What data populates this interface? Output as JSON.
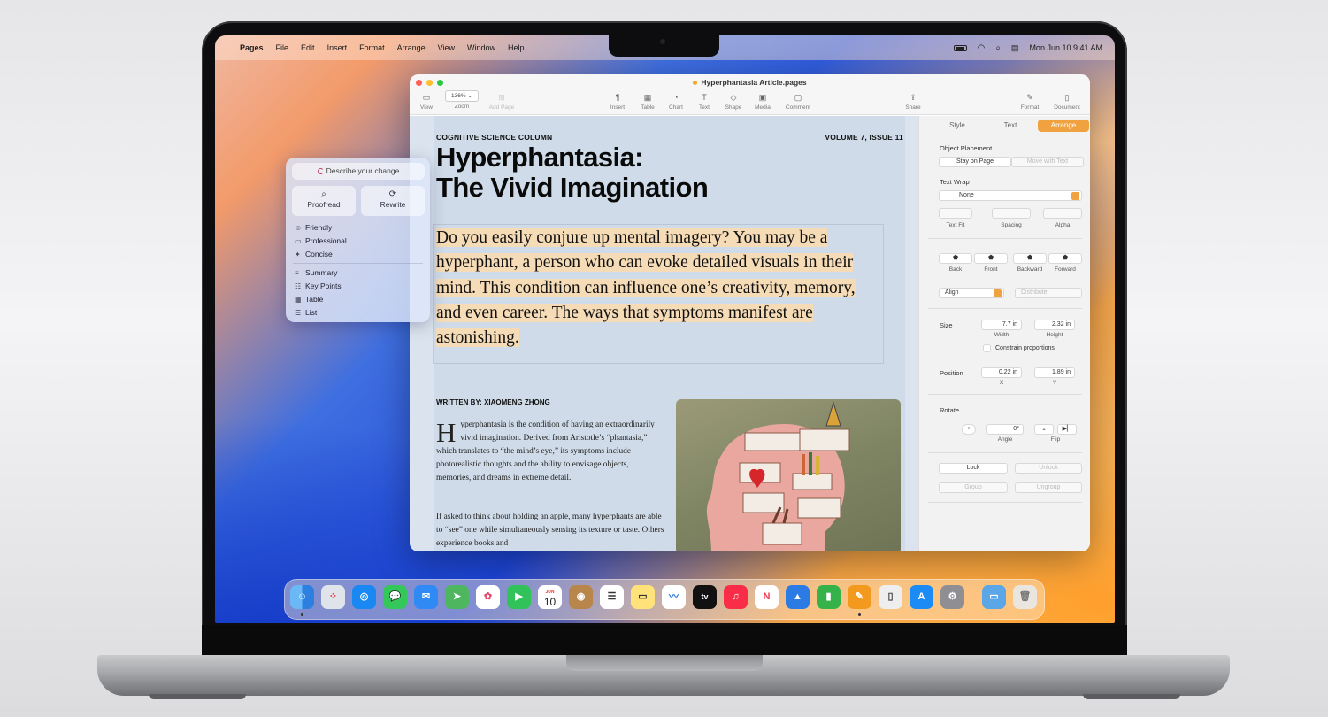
{
  "menubar": {
    "app": "Pages",
    "items": [
      "File",
      "Edit",
      "Insert",
      "Format",
      "Arrange",
      "View",
      "Window",
      "Help"
    ],
    "datetime": "Mon Jun 10  9:41 AM"
  },
  "window": {
    "title": "Hyperphantasia Article.pages",
    "zoom_value": "136% ⌄",
    "toolbar": [
      {
        "label": "View",
        "icon": "sidebar-icon"
      },
      {
        "label": "Zoom",
        "icon": "zoom-icon"
      },
      {
        "label": "Add Page",
        "icon": "add-page-icon"
      },
      {
        "label": "Insert",
        "icon": "insert-icon"
      },
      {
        "label": "Table",
        "icon": "table-icon"
      },
      {
        "label": "Chart",
        "icon": "chart-icon"
      },
      {
        "label": "Text",
        "icon": "text-icon"
      },
      {
        "label": "Shape",
        "icon": "shape-icon"
      },
      {
        "label": "Media",
        "icon": "media-icon"
      },
      {
        "label": "Comment",
        "icon": "comment-icon"
      },
      {
        "label": "Share",
        "icon": "share-icon"
      },
      {
        "label": "Format",
        "icon": "format-brush-icon"
      },
      {
        "label": "Document",
        "icon": "document-icon"
      }
    ]
  },
  "article": {
    "kicker_left": "COGNITIVE SCIENCE COLUMN",
    "kicker_right": "VOLUME 7, ISSUE 11",
    "headline_line1": "Hyperphantasia:",
    "headline_line2": "The Vivid Imagination",
    "lede": "Do you easily conjure up mental imagery? You may be a hyperphant, a person who can evoke detailed visuals in their mind. This condition can influence one’s creativity, memory, and even career. The ways that symptoms manifest are astonishing.",
    "byline": "WRITTEN BY: XIAOMENG ZHONG",
    "dropcap": "H",
    "body1": "yperphantasia is the condition of having an extraordinarily vivid imagination. Derived from Aristotle’s “phantasia,” which translates to “the mind’s eye,” its symptoms include photorealistic thoughts and the ability to envisage objects, memories, and dreams in extreme detail.",
    "body2": "If asked to think about holding an apple, many hyperphants are able to “see” one while simultaneously sensing its texture or taste. Others experience books and"
  },
  "writing_tools": {
    "input_placeholder": "Describe your change",
    "proofread": "Proofread",
    "rewrite": "Rewrite",
    "tones": [
      "Friendly",
      "Professional",
      "Concise"
    ],
    "formats": [
      "Summary",
      "Key Points",
      "Table",
      "List"
    ]
  },
  "inspector": {
    "tabs": [
      "Style",
      "Text",
      "Arrange"
    ],
    "object_placement": "Object Placement",
    "stay_on_page": "Stay on Page",
    "move_with_text": "Move with Text",
    "text_wrap": "Text Wrap",
    "wrap_value": "None",
    "text_fit": "Text Fit",
    "spacing": "Spacing",
    "alpha": "Alpha",
    "order": [
      "Back",
      "Front",
      "Backward",
      "Forward"
    ],
    "align": "Align",
    "distribute": "Distribute",
    "size": "Size",
    "width_value": "7.7 in",
    "height_value": "2.32 in",
    "width": "Width",
    "height": "Height",
    "constrain": "Constrain proportions",
    "position": "Position",
    "x_value": "0.22 in",
    "y_value": "1.89 in",
    "x": "X",
    "y": "Y",
    "rotate": "Rotate",
    "angle_value": "0°",
    "angle": "Angle",
    "flip": "Flip",
    "lock": "Lock",
    "unlock": "Unlock",
    "group": "Group",
    "ungroup": "Ungroup"
  },
  "dock": {
    "calendar_month": "JUN",
    "calendar_day": "10",
    "tv_label": "tv",
    "apps": [
      "finder-icon",
      "launchpad-icon",
      "safari-icon",
      "messages-icon",
      "mail-icon",
      "maps-icon",
      "photos-icon",
      "facetime-icon",
      "calendar-icon",
      "contacts-icon",
      "reminders-icon",
      "notes-icon",
      "freeform-icon",
      "apple-tv-icon",
      "music-icon",
      "news-icon",
      "keynote-icon",
      "numbers-icon",
      "pages-icon",
      "iphone-mirroring-icon",
      "app-store-icon",
      "system-settings-icon",
      "downloads-folder-icon",
      "trash-icon"
    ],
    "colors": {
      "accent": "#f0a240",
      "highlight": "#f5dcb7"
    }
  }
}
